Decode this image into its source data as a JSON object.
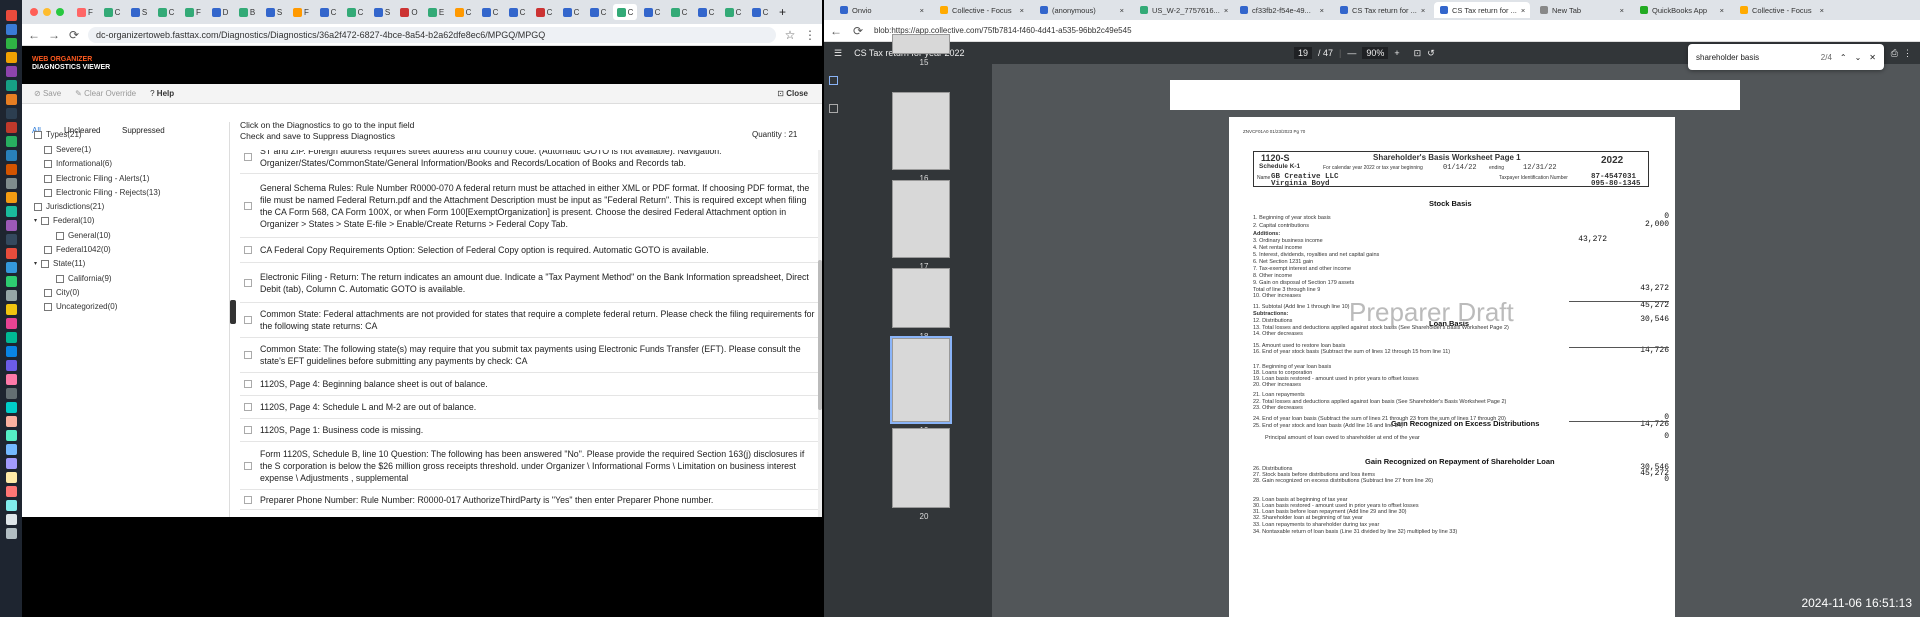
{
  "left": {
    "tabs": [
      "F",
      "C",
      "S",
      "C",
      "F",
      "D",
      "B",
      "S",
      "F",
      "C",
      "C",
      "S",
      "O",
      "E",
      "C",
      "C",
      "C",
      "C",
      "C",
      "C",
      "C",
      "C",
      "C",
      "C",
      "C",
      "C"
    ],
    "url": "dc-organizertoweb.fasttax.com/Diagnostics/Diagnostics/36a2f472-6827-4bce-8a54-b2a62dfe8ec6/MPGQ/MPGQ",
    "logo": [
      "WEB ORGANIZER",
      "DIAGNOSTICS VIEWER"
    ],
    "toolbar": {
      "save": "Save",
      "clear": "Clear Override",
      "help": "Help",
      "close": "Close"
    },
    "filter_tabs": [
      "All",
      "Uncleared",
      "Suppressed"
    ],
    "tree": [
      "Types(21)",
      "Severe(1)",
      "Informational(6)",
      "Electronic Filing - Alerts(1)",
      "Electronic Filing - Rejects(13)",
      "Jurisdictions(21)",
      "Federal(10)",
      "General(10)",
      "Federal1042(0)",
      "State(11)",
      "California(9)",
      "City(0)",
      "Uncategorized(0)"
    ],
    "hint1": "Click on the Diagnostics to go to the input field",
    "hint2": "Check and save to Suppress Diagnostics",
    "quantity": "Quantity : 21",
    "rows": [
      "ST and ZIP. Foreign address requires street address and country code. (Automatic GOTO is not available). Navigation: Organizer/States/CommonState/General Information/Books and Records/Location of Books and Records tab.",
      "General Schema Rules: Rule Number R0000-070 A federal return must be attached in either XML or PDF format. If choosing PDF format, the file must be named Federal Return.pdf and the Attachment Description must be input as \"Federal Return\". This is required except when filing the CA Form 568, CA Form 100X, or when Form 100[ExemptOrganization] is present. Choose the desired Federal Attachment option in Organizer > States > State E-file > Enable/Create Returns > Federal Copy Tab.",
      "CA Federal Copy Requirements Option: Selection of Federal Copy option is required. Automatic GOTO is available.",
      "Electronic Filing - Return: The return indicates an amount due. Indicate a \"Tax Payment Method\" on the Bank Information spreadsheet, Direct Debit (tab), Column C. Automatic GOTO is available.",
      "Common State: Federal attachments are not provided for states that require a complete federal return. Please check the filing requirements for the following state returns: CA",
      "Common State: The following state(s) may require that you submit tax payments using Electronic Funds Transfer (EFT). Please consult the state's EFT guidelines before submitting any payments by check: CA",
      "1120S, Page 4: Beginning balance sheet is out of balance.",
      "1120S, Page 4: Schedule L and M-2 are out of balance.",
      "1120S, Page 1: Business code is missing.",
      "Form 1120S, Schedule B, line 10 Question: The following has been answered \"No\". Please provide the required Section 163(j) disclosures if the S corporation is below the $26 million gross receipts threshold. under Organizer \\ Informational Forms \\ Limitation on business interest expense \\ Adjustments , supplemental",
      "Preparer Phone Number: Rule Number: R0000-017 AuthorizeThirdParty is \"Yes\" then enter Preparer Phone number."
    ]
  },
  "right": {
    "tabs": [
      "Onvio",
      "Collective - Focus",
      "(anonymous)",
      "US_W-2_7757616...",
      "cf33fb2-f54e-49...",
      "CS Tax return for ...",
      "CS Tax return for ...",
      "New Tab",
      "QuickBooks App",
      "Collective - Focus"
    ],
    "url": "blob:https://app.collective.com/75fb7814-f460-4d41-a535-96bb2c49e545",
    "doc_title": "CS Tax return for year 2022",
    "page": "19",
    "pages": "/ 47",
    "zoom": "90%",
    "find_text": "shareholder basis",
    "find_count": "2/4",
    "thumb_labels": [
      "15",
      "16",
      "17",
      "18",
      "19",
      "20"
    ],
    "form": {
      "header_small": "ZNVCF01A0 01/23/2023 Pg 70",
      "form_no": "1120-S",
      "schedule": "Schedule K-1",
      "title": "Shareholder's Basis Worksheet Page 1",
      "year": "2022",
      "period_label": "For calendar year 2022 or tax year beginning",
      "begin": "01/14/22",
      "ending_label": "ending",
      "end": "12/31/22",
      "name_label": "Name",
      "name1": "GB Creative LLC",
      "name2": "Virginia Boyd",
      "tin_label": "Taxpayer Identification Number",
      "tin1": "87-4547031",
      "tin2": "095-80-1345",
      "stock_title": "Stock Basis",
      "loan_title": "Loan Basis",
      "gain_title": "Gain Recognized on Excess Distributions",
      "gain2_title": "Gain Recognized on Repayment of Shareholder Loan",
      "watermark": "Preparer  Draft",
      "lines": [
        "1. Beginning of year stock basis",
        "2. Capital contributions",
        "Additions:",
        "3. Ordinary business income",
        "4. Net rental income",
        "5. Interest, dividends, royalties and net capital gains",
        "6. Net Section 1231 gain",
        "7. Tax-exempt interest and other income",
        "8. Other income",
        "9. Gain on disposal of Section 179 assets",
        "Total of line 3 through line 9",
        "10. Other increases",
        "11. Subtotal (Add line 1 through line 10)",
        "Subtractions:",
        "12. Distributions",
        "13. Total losses and deductions applied against stock basis (See Shareholder's Basis Worksheet Page 2)",
        "14. Other decreases",
        "15. Amount used to restore loan basis",
        "16. End of year stock basis (Subtract the sum of lines 12 through 15 from line 11)",
        "17. Beginning of year loan basis",
        "18. Loans to corporation",
        "19. Loan basis restored - amount used in prior years to offset losses",
        "20. Other increases",
        "21. Loan repayments",
        "22. Total losses and deductions applied against loan basis (See Shareholder's Basis Worksheet Page 2)",
        "23. Other decreases",
        "24. End of year loan basis (Subtract the sum of lines 21 through 23 from the sum of lines 17 through 20)",
        "25. End of year stock and loan basis (Add line 16 and line 24)",
        "Principal amount of loan owed to shareholder at end of the year",
        "26. Distributions",
        "27. Stock basis before distributions and loss items",
        "28. Gain recognized on excess distributions (Subtract line 27 from line 26)",
        "29. Loan basis at beginning of tax year",
        "30. Loan basis restored - amount used in prior years to offset losses",
        "31. Loan basis before loan repayment (Add line 29 and line 30)",
        "32. Shareholder loan at beginning of tax year",
        "33. Loan repayments to shareholder during tax year",
        "34. Nontaxable return of loan basis (Line 31 divided by line 32) multiplied by line 33)"
      ],
      "values": {
        "l1": "0",
        "l2": "2,000",
        "l3": "43,272",
        "l9": "43,272",
        "l11": "45,272",
        "l12": "30,546",
        "l16": "14,726",
        "l24": "0",
        "l25": "14,726",
        "lp": "0",
        "l26": "30,546",
        "l27": "45,272",
        "l28": "0"
      }
    }
  },
  "timestamp": "2024-11-06 16:51:13"
}
